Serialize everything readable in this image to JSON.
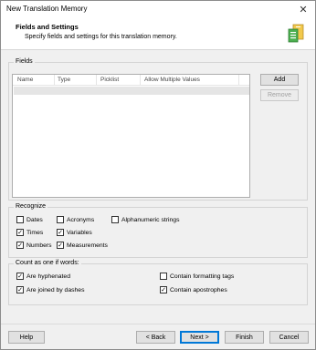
{
  "window": {
    "title": "New Translation Memory",
    "close_glyph": "✕"
  },
  "header": {
    "title": "Fields and Settings",
    "subtitle": "Specify fields and settings for this translation memory."
  },
  "fields": {
    "group_label": "Fields",
    "columns": [
      "Name",
      "Type",
      "Picklist",
      "Allow Multiple Values"
    ],
    "add_label": "Add",
    "remove_label": "Remove"
  },
  "recognize": {
    "group_label": "Recognize",
    "items": [
      {
        "label": "Dates",
        "checked": false
      },
      {
        "label": "Acronyms",
        "checked": false
      },
      {
        "label": "Alphanumeric strings",
        "checked": false
      },
      {
        "label": "Times",
        "checked": true
      },
      {
        "label": "Variables",
        "checked": true
      },
      {
        "label": "Numbers",
        "checked": true
      },
      {
        "label": "Measurements",
        "checked": true
      }
    ]
  },
  "count_as_one": {
    "group_label": "Count as one if words:",
    "items": [
      {
        "label": "Are hyphenated",
        "checked": true
      },
      {
        "label": "Contain formatting tags",
        "checked": false
      },
      {
        "label": "Are joined by dashes",
        "checked": true
      },
      {
        "label": "Contain apostrophes",
        "checked": true
      }
    ]
  },
  "footer": {
    "help": "Help",
    "back": "< Back",
    "next": "Next >",
    "finish": "Finish",
    "cancel": "Cancel"
  },
  "check_glyph": "✓"
}
